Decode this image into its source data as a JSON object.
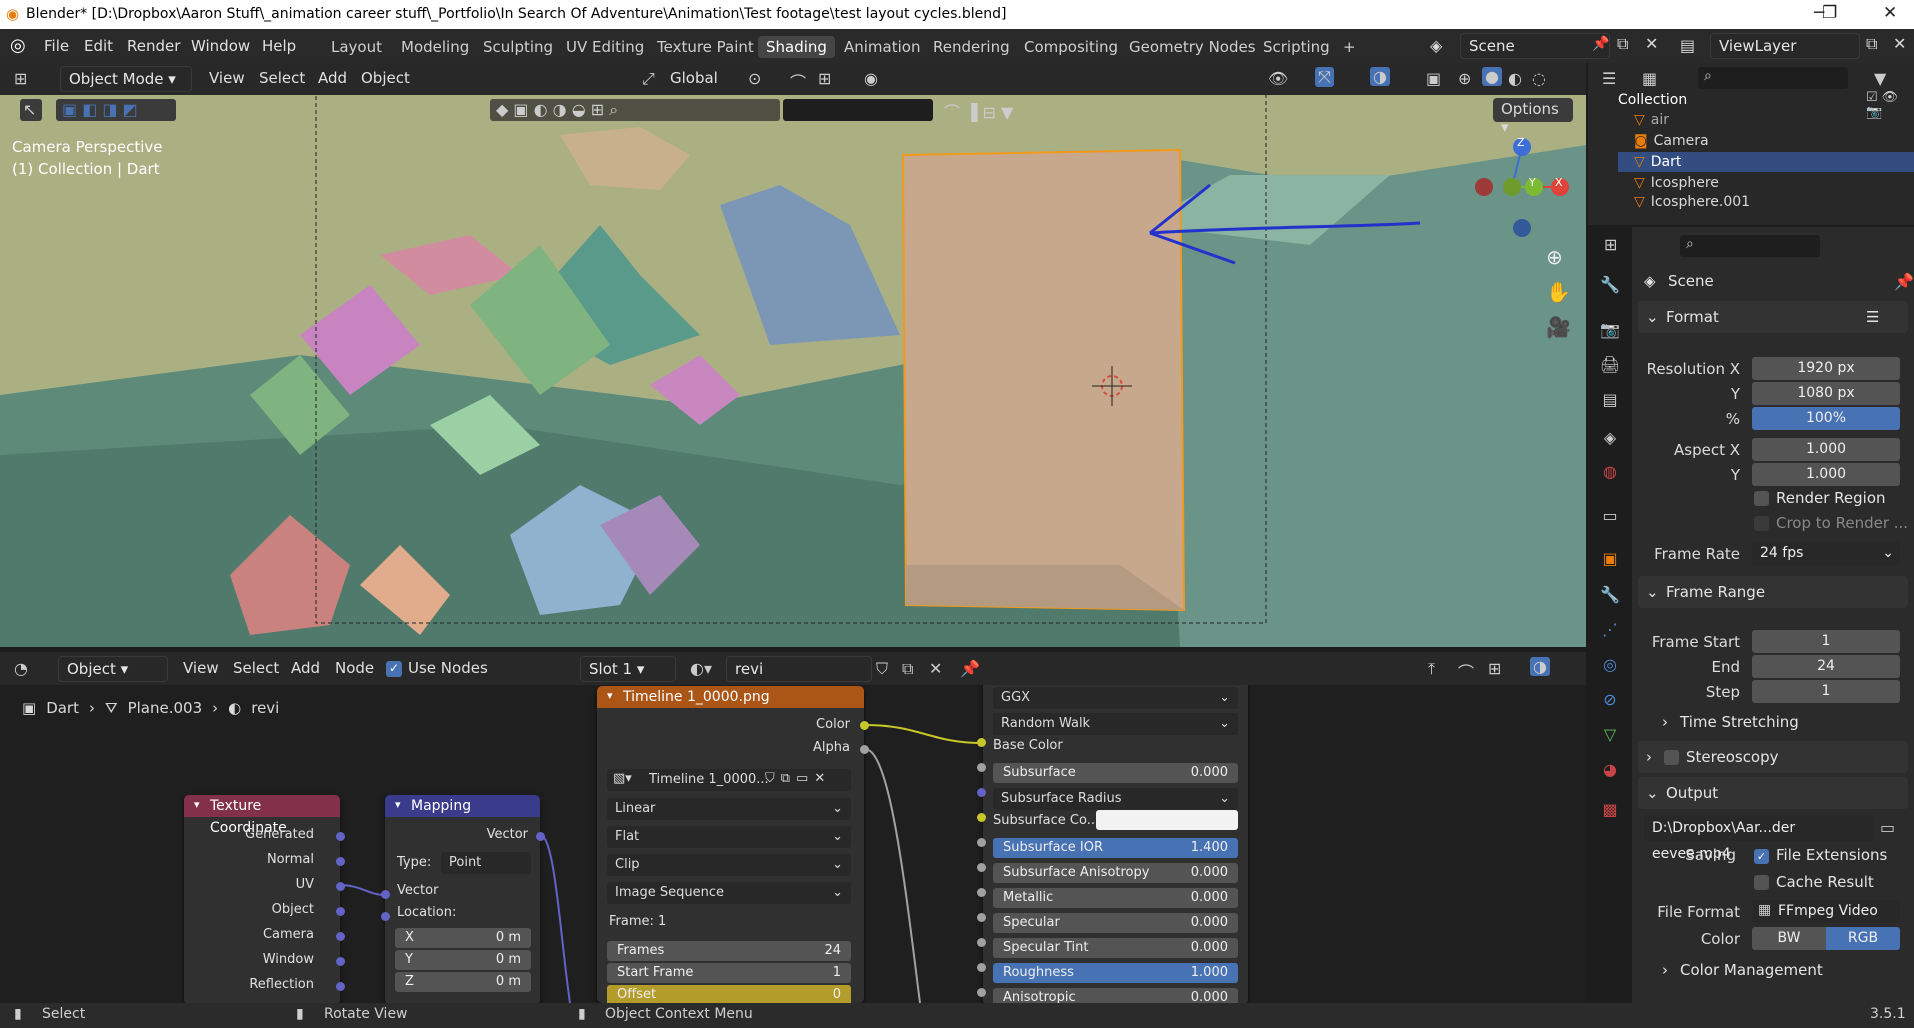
{
  "title_bar": {
    "app_icon": "blender-logo-icon",
    "title": "Blender* [D:\\Dropbox\\Aaron Stuff\\_animation career stuff\\_Portfolio\\In Search Of Adventure\\Animation\\Test footage\\test layout cycles.blend]",
    "minimize": "─",
    "maximize": "❐",
    "close": "✕"
  },
  "menu": {
    "items": [
      "File",
      "Edit",
      "Render",
      "Window",
      "Help"
    ]
  },
  "workspaces": {
    "tabs": [
      "Layout",
      "Modeling",
      "Sculpting",
      "UV Editing",
      "Texture Paint",
      "Shading",
      "Animation",
      "Rendering",
      "Compositing",
      "Geometry Nodes",
      "Scripting",
      "+"
    ],
    "active": "Shading"
  },
  "scene_selector": {
    "scene": "Scene",
    "view_layer": "ViewLayer"
  },
  "viewport_header": {
    "mode": "Object Mode",
    "menus": [
      "View",
      "Select",
      "Add",
      "Object"
    ],
    "transform_orientation": "Global",
    "options": "Options"
  },
  "viewport": {
    "camera_label": "Camera Perspective",
    "collection_label": "(1) Collection | Dart",
    "gizmo_z": "Z",
    "gizmo_y": "Y",
    "gizmo_x": "X"
  },
  "node_header": {
    "editor": "Object",
    "menus": [
      "View",
      "Select",
      "Add",
      "Node"
    ],
    "use_nodes": "Use Nodes",
    "slot": "Slot 1",
    "material": "revi"
  },
  "breadcrumb": {
    "object": "Dart",
    "mesh": "Plane.003",
    "material": "revi"
  },
  "nodes": {
    "texcoord": {
      "title": "Texture Coordinate",
      "outputs": [
        "Generated",
        "Normal",
        "UV",
        "Object",
        "Camera",
        "Window",
        "Reflection"
      ]
    },
    "mapping": {
      "title": "Mapping",
      "output": "Vector",
      "type_label": "Type:",
      "type_value": "Point",
      "input": "Vector",
      "location": "Location:",
      "fields": [
        {
          "k": "X",
          "v": "0 m"
        },
        {
          "k": "Y",
          "v": "0 m"
        },
        {
          "k": "Z",
          "v": "0 m"
        }
      ]
    },
    "image": {
      "title": "Timeline 1_0000.png",
      "out_color": "Color",
      "out_alpha": "Alpha",
      "image_name": "Timeline 1_0000...",
      "dropdowns": [
        "Linear",
        "Flat",
        "Clip",
        "Image Sequence"
      ],
      "frame_text": "Frame: 1",
      "fields": [
        {
          "k": "Frames",
          "v": "24"
        },
        {
          "k": "Start Frame",
          "v": "1"
        },
        {
          "k": "Offset",
          "v": "0"
        }
      ]
    },
    "bsdf": {
      "dropdowns": [
        "GGX",
        "Random Walk"
      ],
      "base_color": "Base Color",
      "rows": [
        {
          "k": "Subsurface",
          "v": "0.000",
          "hl": false
        },
        {
          "k": "Subsurface Radius",
          "v": "",
          "hl": false
        },
        {
          "k": "Subsurface Co...",
          "v": "",
          "hl": false
        },
        {
          "k": "Subsurface IOR",
          "v": "1.400",
          "hl": true
        },
        {
          "k": "Subsurface Anisotropy",
          "v": "0.000",
          "hl": false
        },
        {
          "k": "Metallic",
          "v": "0.000",
          "hl": false
        },
        {
          "k": "Specular",
          "v": "0.000",
          "hl": false
        },
        {
          "k": "Specular Tint",
          "v": "0.000",
          "hl": false
        },
        {
          "k": "Roughness",
          "v": "1.000",
          "hl": true
        },
        {
          "k": "Anisotropic",
          "v": "0.000",
          "hl": false
        }
      ]
    }
  },
  "outliner": {
    "items": [
      {
        "name": "Collection",
        "indent": 0
      },
      {
        "name": "air",
        "indent": 1
      },
      {
        "name": "Camera",
        "indent": 1
      },
      {
        "name": "Dart",
        "indent": 1,
        "selected": true
      },
      {
        "name": "Icosphere",
        "indent": 1
      },
      {
        "name": "Icosphere.001",
        "indent": 1
      }
    ]
  },
  "properties": {
    "context": "Scene",
    "format": {
      "title": "Format",
      "res_x_label": "Resolution X",
      "res_x": "1920 px",
      "res_y_label": "Y",
      "res_y": "1080 px",
      "pct_label": "%",
      "pct": "100%",
      "aspect_x_label": "Aspect X",
      "aspect_x": "1.000",
      "aspect_y_label": "Y",
      "aspect_y": "1.000",
      "render_region": "Render Region",
      "crop": "Crop to Render ...",
      "frame_rate_label": "Frame Rate",
      "frame_rate": "24 fps"
    },
    "frame_range": {
      "title": "Frame Range",
      "start_label": "Frame Start",
      "start": "1",
      "end_label": "End",
      "end": "24",
      "step_label": "Step",
      "step": "1",
      "time_stretching": "Time Stretching"
    },
    "stereoscopy": "Stereoscopy",
    "output": {
      "title": "Output",
      "path": "D:\\Dropbox\\Aar...der eevee.mp4",
      "saving_label": "Saving",
      "file_ext": "File Extensions",
      "cache": "Cache Result",
      "file_format_label": "File Format",
      "file_format": "FFmpeg Video",
      "color_label": "Color",
      "bw": "BW",
      "rgb": "RGB",
      "color_mgmt": "Color Management"
    }
  },
  "status_bar": {
    "select": "Select",
    "rotate": "Rotate View",
    "context": "Object Context Menu",
    "version": "3.5.1"
  }
}
